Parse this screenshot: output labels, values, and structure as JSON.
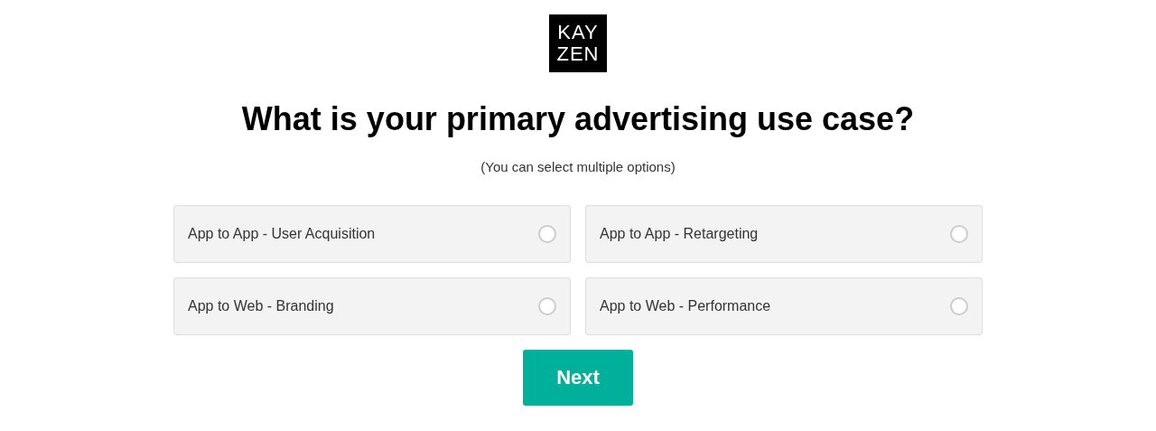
{
  "logo": {
    "lines": [
      "KAY",
      "ZEN"
    ]
  },
  "title": "What is your primary advertising use case?",
  "subtitle": "(You can select multiple options)",
  "options": [
    {
      "label": "App to App - User Acquisition",
      "selected": false
    },
    {
      "label": "App to App - Retargeting",
      "selected": false
    },
    {
      "label": "App to Web - Branding",
      "selected": false
    },
    {
      "label": "App to Web - Performance",
      "selected": false
    }
  ],
  "next_button": "Next"
}
